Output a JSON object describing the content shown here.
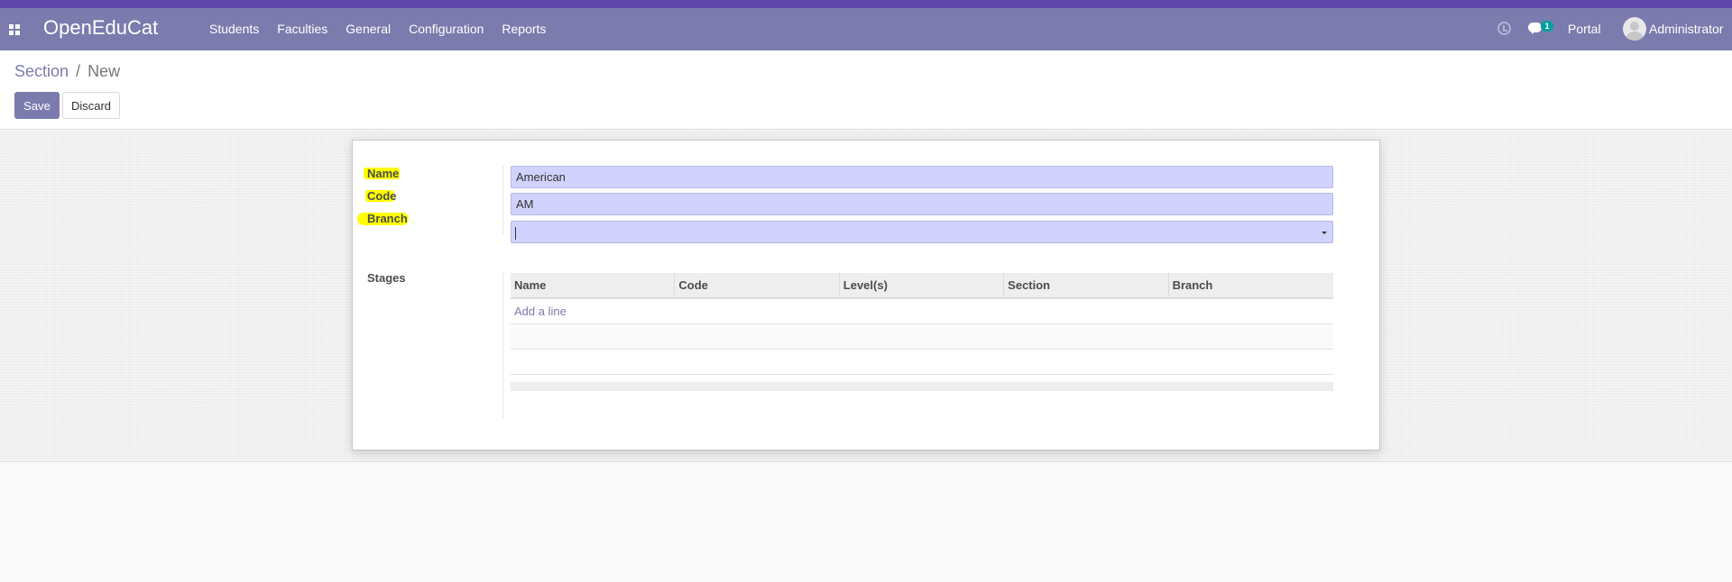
{
  "navbar": {
    "brand": "OpenEduCat",
    "menu": [
      {
        "label": "Students"
      },
      {
        "label": "Faculties"
      },
      {
        "label": "General"
      },
      {
        "label": "Configuration"
      },
      {
        "label": "Reports"
      }
    ],
    "icons": [
      "apps-grid-icon",
      "clock-icon",
      "chat-icon"
    ],
    "chat_badge": "1",
    "portal_label": "Portal",
    "user_name": "Administrator"
  },
  "control_panel": {
    "breadcrumb": {
      "parent": "Section",
      "separator": "/",
      "current": "New"
    },
    "save_label": "Save",
    "discard_label": "Discard"
  },
  "form": {
    "fields": [
      {
        "label": "Name",
        "value": "American"
      },
      {
        "label": "Code",
        "value": "AM"
      },
      {
        "label": "Branch",
        "value": ""
      }
    ],
    "stages": {
      "label": "Stages",
      "columns": [
        "Name",
        "Code",
        "Level(s)",
        "Section",
        "Branch"
      ],
      "add_line_label": "Add a line"
    }
  },
  "colors": {
    "topstripe": "#5f46a8",
    "navbar": "#7c7bad",
    "input_bg": "#d2d2ff",
    "highlight": "#ffff00"
  }
}
